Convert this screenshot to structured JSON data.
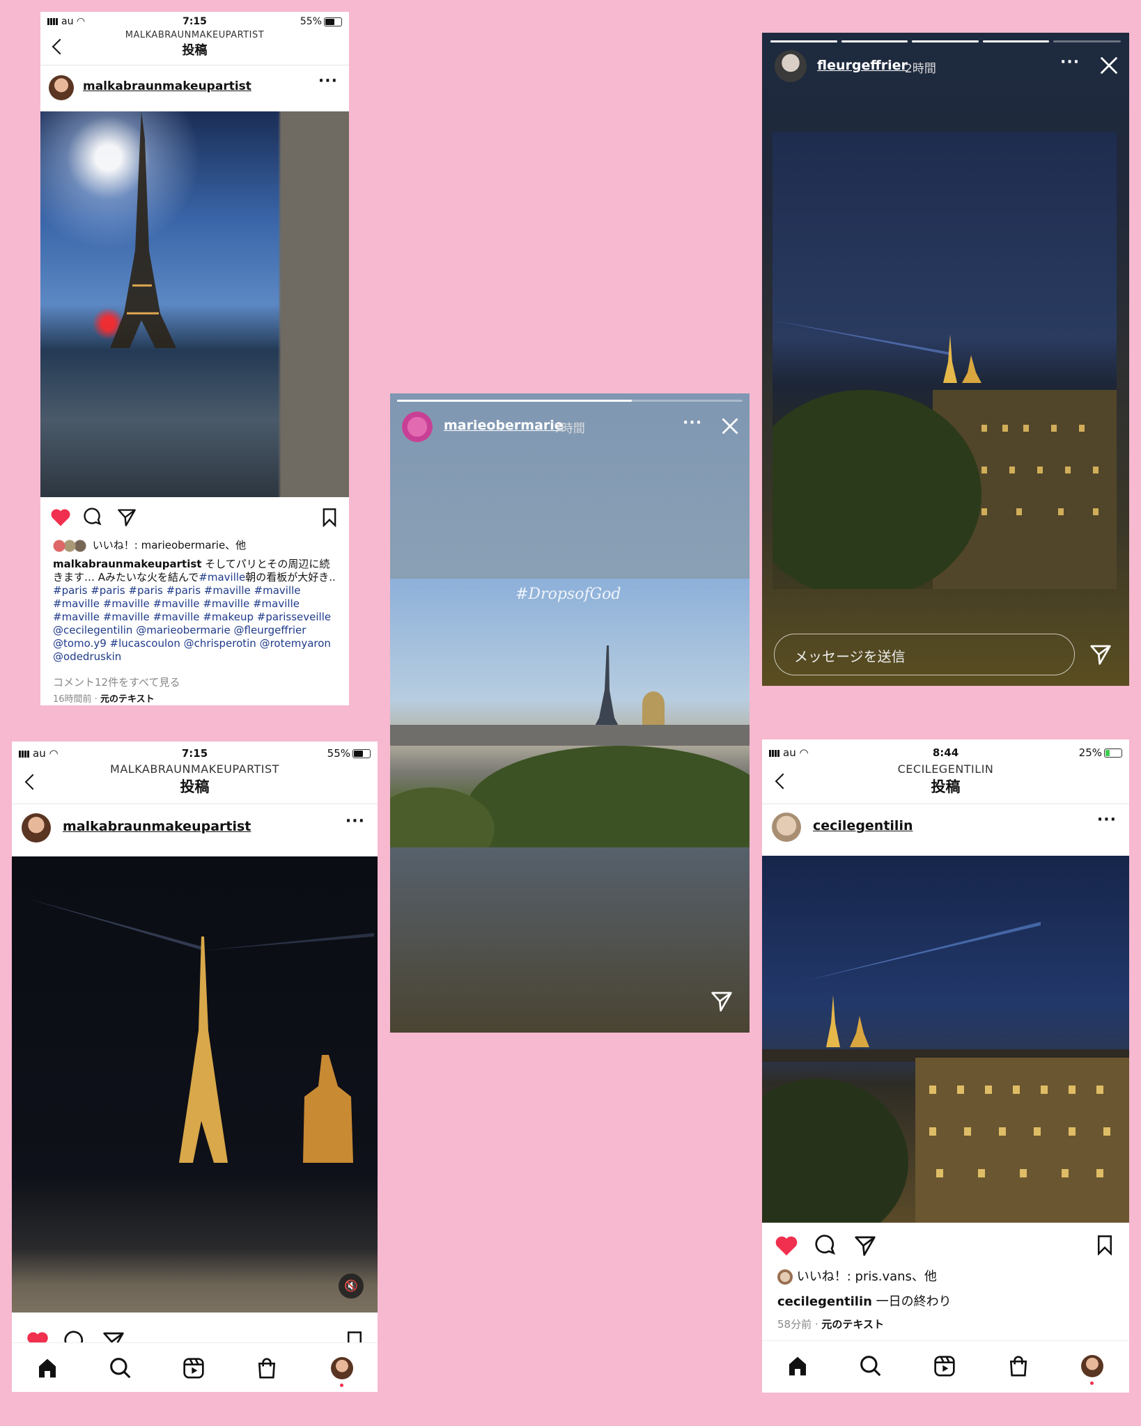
{
  "panel1": {
    "status": {
      "carrier": "au",
      "time": "7:15",
      "battery": "55%"
    },
    "header": {
      "sup": "MALKABRAUNMAKEUPARTIST",
      "title": "投稿"
    },
    "user": "malkabraunmakeupartist",
    "likes": "いいね！: marieobermarie、他",
    "caption_user": "malkabraunmakeupartist",
    "caption_text": " そしてパリとその周辺に続きます… Aみたいな火を結んで",
    "caption_tag1": "#maville",
    "caption_text2": "朝の看板が大好き..",
    "hashtags": "#paris #paris #paris #paris #maville #maville #maville #maville #maville #maville #maville #maville #maville #maville #makeup #parisseveille @cecilegentilin @marieobermarie @fleurgeffrier @tomo.y9 #lucascoulon @chrisperotin @rotemyaron @odedruskin",
    "comments": "コメント12件をすべて見る",
    "time": "16時間前",
    "translate": "元のテキスト"
  },
  "panel2": {
    "status": {
      "carrier": "au",
      "time": "7:15",
      "battery": "55%"
    },
    "header": {
      "sup": "MALKABRAUNMAKEUPARTIST",
      "title": "投稿"
    },
    "user": "malkabraunmakeupartist"
  },
  "story1": {
    "user": "marieobermarie",
    "time": "7時間",
    "overlay": "#DropsofGod"
  },
  "story2": {
    "user": "fleurgeffrier",
    "time": "2時間",
    "placeholder": "メッセージを送信"
  },
  "panel3": {
    "status": {
      "carrier": "au",
      "time": "8:44",
      "battery": "25%"
    },
    "header": {
      "sup": "CECILEGENTILIN",
      "title": "投稿"
    },
    "user": "cecilegentilin",
    "likes": "いいね！: pris.vans、他",
    "caption_user": "cecilegentilin",
    "caption_text": " 一日の終わり",
    "time": "58分前",
    "translate": "元のテキスト"
  },
  "colors": {
    "heart": "#f0304e",
    "background": "#f6b9cf",
    "tag": "#1e3a8a"
  },
  "icons": [
    "heart-icon",
    "comment-icon",
    "share-icon",
    "bookmark-icon",
    "home-icon",
    "search-icon",
    "reels-icon",
    "shop-icon",
    "close-icon",
    "mute-icon"
  ]
}
